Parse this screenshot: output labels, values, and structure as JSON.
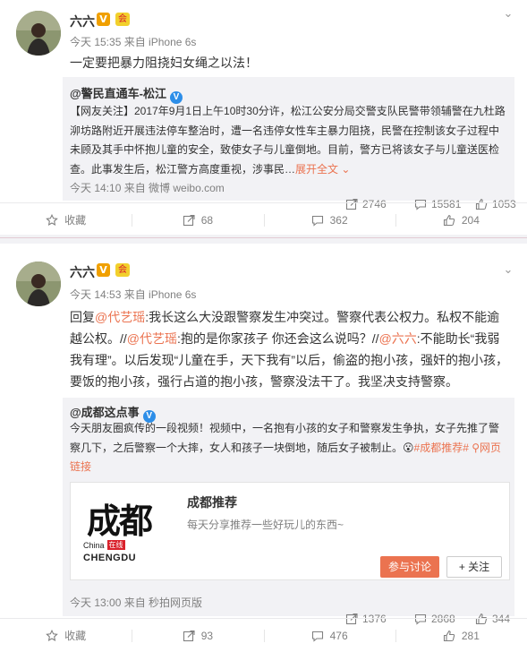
{
  "posts": [
    {
      "user": "六六",
      "vip_badge": "V",
      "club_badge": "会",
      "time": "今天 15:35",
      "source": "来自 iPhone 6s",
      "text": "一定要把暴力阻挠妇女绳之以法！",
      "repost": {
        "author": "@警民直通车-松江",
        "author_badge": "V",
        "text_prefix": "【网友关注】2017年9月1日上午10时30分许，松江公安分局交警支队民警带领辅警在九杜路泖坊路附近开展违法停车整治时，遭一名违停女性车主暴力阻挠，民警在控制该女子过程中未顾及其手中怀抱儿童的安全，致使女子与儿童倒地。目前，警方已将该女子与儿童送医检查。此事发生后，松江警方高度重视，涉事民…",
        "expand_label": "展开全文",
        "expand_icon": "chevron-down-icon",
        "time": "今天 14:10",
        "source": "来自 微博 weibo.com",
        "forwards": "2746",
        "comments": "15581",
        "likes": "1053"
      },
      "actions": {
        "favorite": "收藏",
        "forwards": "68",
        "comments": "362",
        "likes": "204"
      }
    },
    {
      "user": "六六",
      "vip_badge": "V",
      "club_badge": "会",
      "time": "今天 14:53",
      "source": "来自 iPhone 6s",
      "text_parts": [
        {
          "t": "回复",
          "link": false
        },
        {
          "t": "@代艺瑶",
          "link": true
        },
        {
          "t": ":我长这么大没跟警察发生冲突过。警察代表公权力。私权不能逾越公权。//",
          "link": false
        },
        {
          "t": "@代艺瑶",
          "link": true
        },
        {
          "t": ":抱的是你家孩子 你还会这么说吗？//",
          "link": false
        },
        {
          "t": "@六六",
          "link": true
        },
        {
          "t": ":不能助长“我弱我有理”。以后发现“儿童在手，天下我有”以后，偷盗的抱小孩，强奸的抱小孩，要饭的抱小孩，强行占道的抱小孩，警察没法干了。我坚决支持警察。",
          "link": false
        }
      ],
      "repost": {
        "author": "@成都这点事",
        "author_badge": "V",
        "text_prefix": "今天朋友圈疯传的一段视频！视频中，一名抱有小孩的女子和警察发生争执，女子先推了警察几下，之后警察一个大摔，女人和孩子一块倒地，随后女子被制止。",
        "emoji": "😮",
        "topic": "#成都推荐#",
        "weblink": "网页链接",
        "card": {
          "logo_main": "成都",
          "logo_sub_cn": "China",
          "logo_tag": "在线",
          "logo_sub_en": "CHENGDU",
          "title": "成都推荐",
          "desc": "每天分享推荐一些好玩儿的东西~",
          "join_label": "参与讨论",
          "follow_label": "+ 关注"
        },
        "time": "今天 13:00",
        "source": "来自 秒拍网页版",
        "forwards": "1376",
        "comments": "2868",
        "likes": "344"
      },
      "actions": {
        "favorite": "收藏",
        "forwards": "93",
        "comments": "476",
        "likes": "281"
      }
    }
  ],
  "colors": {
    "link": "#eb7350",
    "vip": "#f0a000",
    "verified_blue": "#2d8ee8",
    "repost_bg": "#f2f2f5"
  }
}
